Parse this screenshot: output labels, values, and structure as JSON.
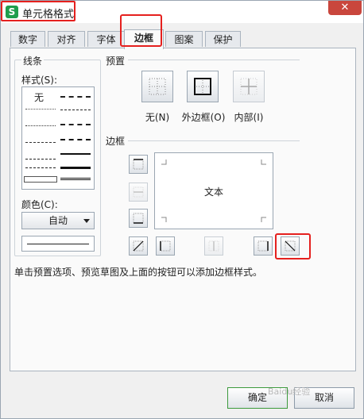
{
  "window": {
    "title": "单元格格式",
    "app_icon": "S",
    "close_glyph": "✕"
  },
  "tabs": [
    {
      "label": "数字",
      "active": false
    },
    {
      "label": "对齐",
      "active": false
    },
    {
      "label": "字体",
      "active": false
    },
    {
      "label": "边框",
      "active": true
    },
    {
      "label": "图案",
      "active": false
    },
    {
      "label": "保护",
      "active": false
    }
  ],
  "line_group": {
    "title": "线条",
    "style_label": "样式(S):",
    "none_label": "无",
    "color_label": "颜色(C):",
    "color_value": "自动"
  },
  "presets": {
    "title": "预置",
    "items": [
      {
        "label": "无(N)",
        "icon": "no-border-icon"
      },
      {
        "label": "外边框(O)",
        "icon": "outline-border-icon"
      },
      {
        "label": "内部(I)",
        "icon": "inside-border-icon"
      }
    ]
  },
  "border": {
    "title": "边框",
    "preview_text": "文本"
  },
  "hint": "单击预置选项、预览草图及上面的按钮可以添加边框样式。",
  "footer": {
    "ok_label": "确定",
    "cancel_label": "取消"
  },
  "watermark": "Baidu经验",
  "colors": {
    "highlight": "#e5201e",
    "app_icon": "#1f9e4d",
    "close": "#c9463d"
  }
}
